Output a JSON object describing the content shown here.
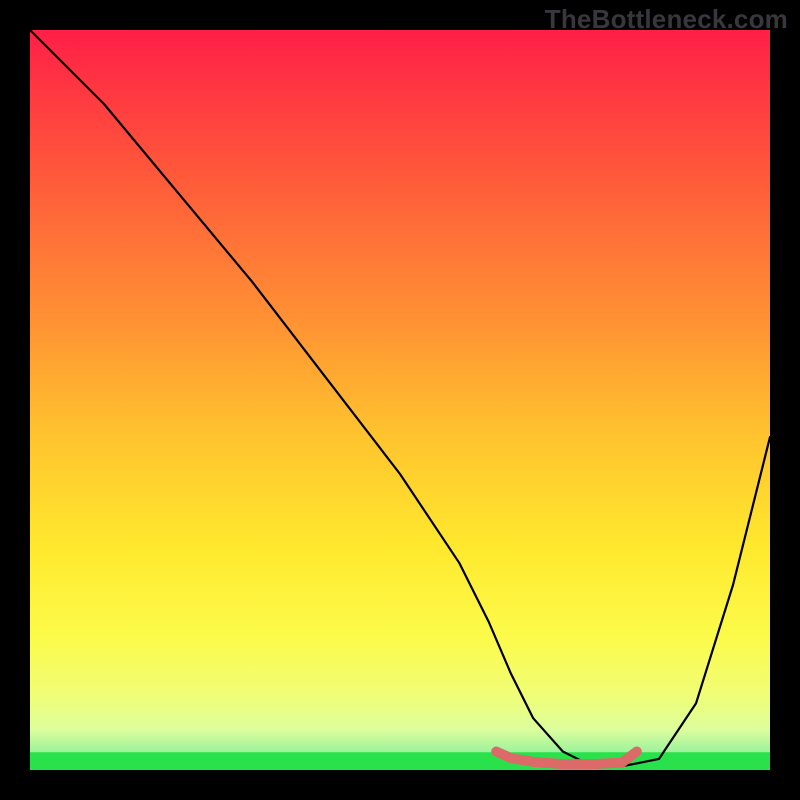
{
  "watermark": "TheBottleneck.com",
  "chart_data": {
    "type": "line",
    "title": "",
    "xlabel": "",
    "ylabel": "",
    "xlim": [
      0,
      100
    ],
    "ylim": [
      0,
      100
    ],
    "grid": false,
    "series": [
      {
        "name": "curve",
        "color": "#000000",
        "x": [
          0,
          3,
          10,
          20,
          30,
          40,
          50,
          58,
          62,
          65,
          68,
          72,
          76,
          80,
          85,
          90,
          95,
          100
        ],
        "y": [
          100,
          97,
          90,
          78,
          66,
          53,
          40,
          28,
          20,
          13,
          7,
          2.5,
          0.5,
          0.5,
          1.5,
          9,
          25,
          45
        ]
      }
    ],
    "ideal_band": {
      "y0": 0,
      "y1": 2.4,
      "color": "#29e24b"
    },
    "marker_segment": {
      "points": [
        [
          63,
          2.5
        ],
        [
          65,
          1.6
        ],
        [
          68,
          1.1
        ],
        [
          72,
          0.8
        ],
        [
          76,
          0.8
        ],
        [
          80,
          1.0
        ],
        [
          82,
          2.5
        ]
      ],
      "color": "#dc6a69",
      "width": 10
    },
    "gradient_stops": [
      {
        "offset": 0.0,
        "color": "#ff1f47"
      },
      {
        "offset": 0.2,
        "color": "#ff5a3a"
      },
      {
        "offset": 0.4,
        "color": "#ff9433"
      },
      {
        "offset": 0.55,
        "color": "#ffc42e"
      },
      {
        "offset": 0.7,
        "color": "#ffe92e"
      },
      {
        "offset": 0.82,
        "color": "#fcfb4a"
      },
      {
        "offset": 0.9,
        "color": "#f0fd77"
      },
      {
        "offset": 0.945,
        "color": "#ddfe9d"
      },
      {
        "offset": 0.975,
        "color": "#9df39c"
      },
      {
        "offset": 1.0,
        "color": "#29e24b"
      }
    ]
  }
}
